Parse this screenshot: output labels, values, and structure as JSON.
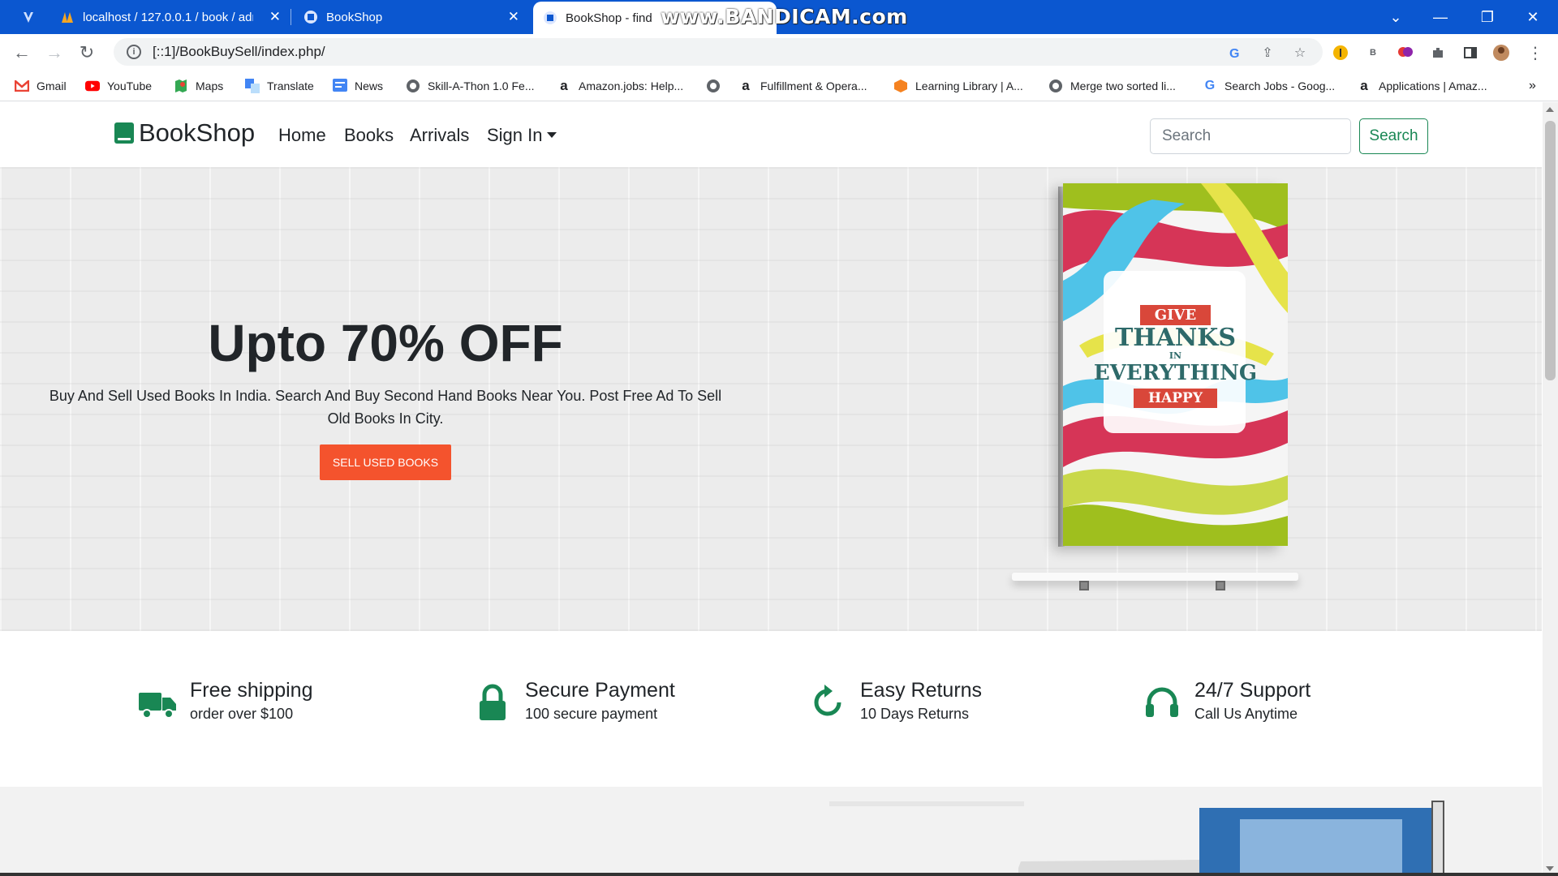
{
  "browser": {
    "tabs": [
      {
        "title": "",
        "icon": "vpn-icon"
      },
      {
        "title": "localhost / 127.0.0.1 / book / adr",
        "icon": "phpmyadmin-icon"
      },
      {
        "title": "BookShop",
        "icon": "site-icon"
      },
      {
        "title": "BookShop - find",
        "icon": "site-icon",
        "active": true
      }
    ],
    "watermark": "www.BANDICAM.com",
    "url": "[::1]/BookBuySell/index.php/",
    "bookmarks": [
      {
        "label": "Gmail",
        "icon": "gmail-icon"
      },
      {
        "label": "YouTube",
        "icon": "youtube-icon"
      },
      {
        "label": "Maps",
        "icon": "maps-icon"
      },
      {
        "label": "Translate",
        "icon": "translate-icon"
      },
      {
        "label": "News",
        "icon": "news-icon"
      },
      {
        "label": "Skill-A-Thon 1.0 Fe...",
        "icon": "globe-icon"
      },
      {
        "label": "Amazon.jobs: Help...",
        "icon": "amazon-icon"
      },
      {
        "label": "",
        "icon": "globe-icon"
      },
      {
        "label": "Fulfillment & Opera...",
        "icon": "amazon-icon"
      },
      {
        "label": "Learning Library | A...",
        "icon": "aws-icon"
      },
      {
        "label": "Merge two sorted li...",
        "icon": "globe-icon"
      },
      {
        "label": "Search Jobs - Goog...",
        "icon": "google-icon"
      },
      {
        "label": "Applications | Amaz...",
        "icon": "amazon-icon"
      }
    ],
    "overflow": "»"
  },
  "site": {
    "brand": "BookShop",
    "nav": {
      "home": "Home",
      "books": "Books",
      "arrivals": "Arrivals",
      "sign_in": "Sign In"
    },
    "search": {
      "placeholder": "Search",
      "button": "Search"
    },
    "hero": {
      "title": "Upto 70% OFF",
      "text": "Buy And Sell Used Books In India. Search And Buy Second Hand Books Near You. Post Free Ad To Sell Old Books In City.",
      "button": "SELL USED BOOKS",
      "book_cover": {
        "line1": "GIVE",
        "line2": "THANKS",
        "line3": "IN",
        "line4": "EVERYTHING",
        "line5": "HAPPY"
      }
    },
    "features": [
      {
        "title": "Free shipping",
        "sub": "order over $100",
        "icon": "truck-icon"
      },
      {
        "title": "Secure Payment",
        "sub": "100 secure payment",
        "icon": "lock-icon"
      },
      {
        "title": "Easy Returns",
        "sub": "10 Days Returns",
        "icon": "refresh-icon"
      },
      {
        "title": "24/7 Support",
        "sub": "Call Us Anytime",
        "icon": "headset-icon"
      }
    ],
    "colors": {
      "accent": "#198754",
      "hero_button": "#f4532d",
      "browser_frame": "#0b57d0"
    }
  }
}
